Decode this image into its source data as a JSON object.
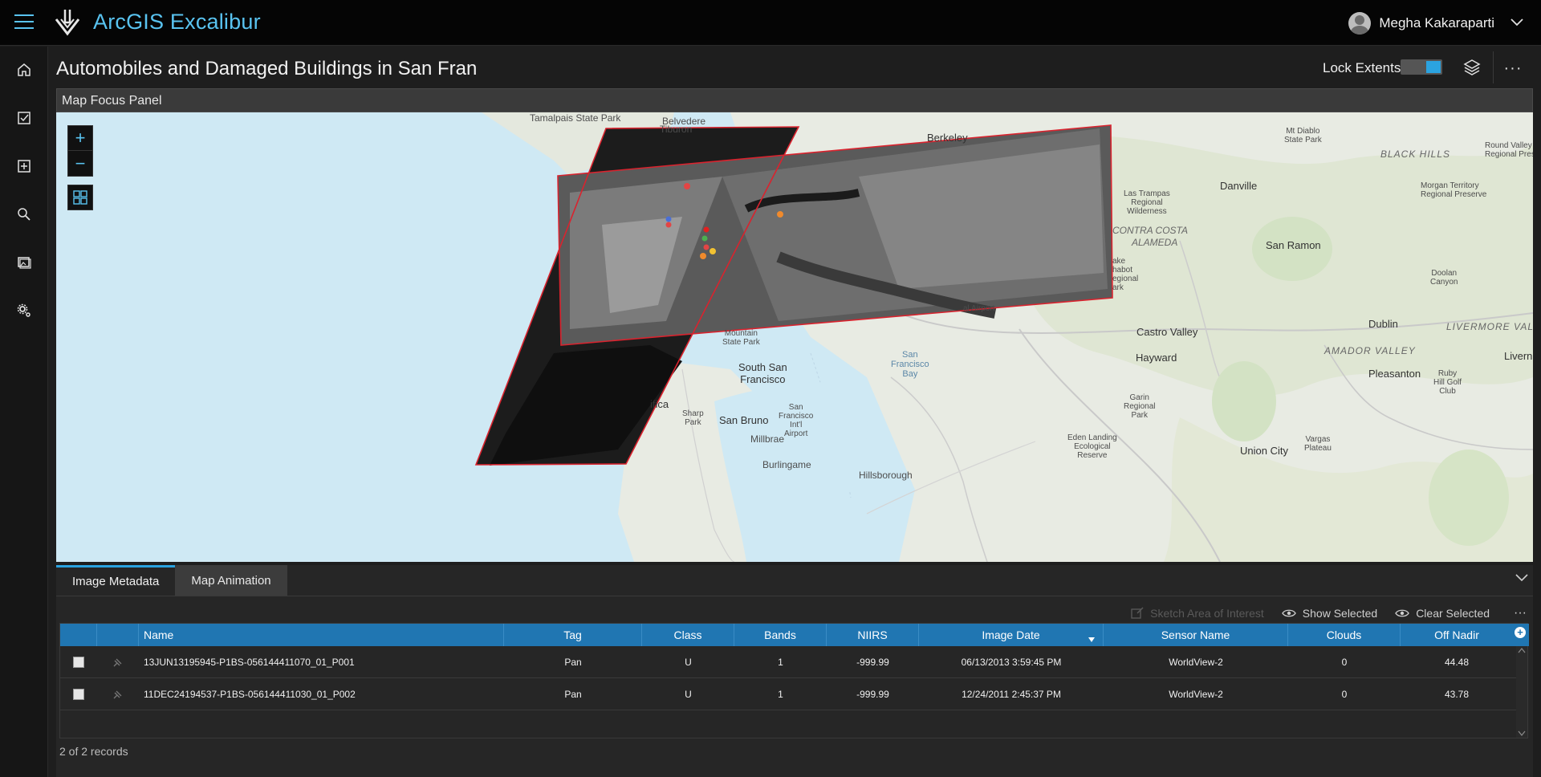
{
  "app": {
    "title": "ArcGIS Excalibur"
  },
  "user": {
    "name": "Megha Kakaraparti"
  },
  "page": {
    "title": "Automobiles and Damaged Buildings in San Fran"
  },
  "header": {
    "lock_label": "Lock Extents",
    "lock_on": true
  },
  "nav": {
    "items": [
      "home-icon",
      "checkbox-icon",
      "add-box-icon",
      "search-icon",
      "images-icon",
      "settings-icon"
    ]
  },
  "map_panel": {
    "title": "Map Focus Panel",
    "zoom_in": "+",
    "zoom_out": "−",
    "labels": {
      "tamalpais": "Tamalpais State Park",
      "belvedere": "Belvedere",
      "tiburon": "Tiburon",
      "berkeley": "Berkeley",
      "mt_diablo": "Mt Diablo\nState Park",
      "black_hills": "BLACK HILLS",
      "round_valley": "Round Valley\nRegional Preserve",
      "danville": "Danville",
      "las_trampas": "Las Trampas\nRegional\nWilderness",
      "morgan_territory": "Morgan Territory\nRegional Preserve",
      "contra_costa": "CONTRA COSTA",
      "alameda": "ALAMEDA",
      "san_ramon": "San Ramon",
      "dublin": "Dublin",
      "castro_valley": "Castro Valley",
      "livermore_valley": "LIVERMORE VALLEY",
      "amador_valley": "AMADOR VALLEY",
      "pleasanton": "Pleasanton",
      "livern": "Livern",
      "hayward": "Hayward",
      "south_san_francisco": "South San\nFrancisco",
      "sf_bay": "San\nFrancisco\nBay",
      "san_bruno": "San Bruno",
      "sfo": "San\nFrancisco\nInt'l\nAirport",
      "millbrae": "Millbrae",
      "burlingame": "Burlingame",
      "hillsborough": "Hillsborough",
      "union_city": "Union City",
      "eden_landing": "Eden Landing\nEcological\nReserve",
      "garin": "Garin\nRegional\nPark",
      "vargas": "Vargas\nPlateau",
      "sharp_park": "Sharp\nPark",
      "mountain_sp": "Mountain\nState Park",
      "pacifica": "ifica",
      "airport": "al Airport",
      "ruby_hill": "Ruby\nHill Golf\nClub",
      "doolan": "Doolan\nCanyon",
      "anthony_chabot": "ake\nhabot\negional\nark"
    }
  },
  "tabs": [
    {
      "label": "Image Metadata",
      "active": true
    },
    {
      "label": "Map Animation",
      "active": false
    }
  ],
  "tools": {
    "sketch": "Sketch Area of Interest",
    "show_selected": "Show Selected",
    "clear_selected": "Clear Selected"
  },
  "table": {
    "columns": [
      "Name",
      "Tag",
      "Class",
      "Bands",
      "NIIRS",
      "Image Date",
      "Sensor Name",
      "Clouds",
      "Off Nadir"
    ],
    "rows": [
      {
        "name": "13JUN13195945-P1BS-056144411070_01_P001",
        "tag": "Pan",
        "class": "U",
        "bands": "1",
        "niirs": "-999.99",
        "date": "06/13/2013 3:59:45 PM",
        "sensor": "WorldView-2",
        "clouds": "0",
        "off_nadir": "44.48"
      },
      {
        "name": "11DEC24194537-P1BS-056144411030_01_P002",
        "tag": "Pan",
        "class": "U",
        "bands": "1",
        "niirs": "-999.99",
        "date": "12/24/2011 2:45:37 PM",
        "sensor": "WorldView-2",
        "clouds": "0",
        "off_nadir": "43.78"
      }
    ],
    "record_count": "2 of 2 records"
  },
  "colors": {
    "accent": "#59c3f0",
    "header_blue": "#2076b2",
    "footprint_red": "#d9232e"
  }
}
